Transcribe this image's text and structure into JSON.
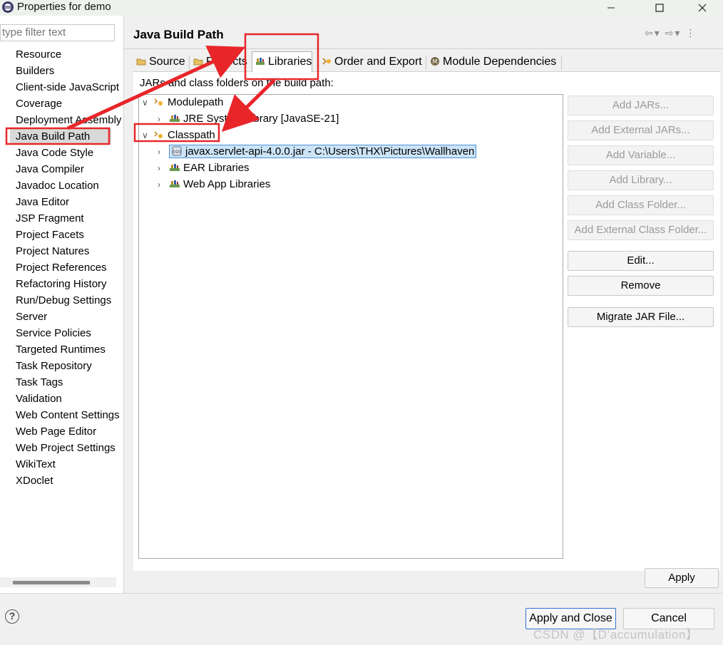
{
  "window": {
    "title": "Properties for demo"
  },
  "filter": {
    "placeholder": "type filter text"
  },
  "nav": {
    "items": [
      {
        "label": "Resource",
        "expandable": true
      },
      {
        "label": "Builders",
        "expandable": false
      },
      {
        "label": "Client-side JavaScript",
        "expandable": true
      },
      {
        "label": "Coverage",
        "expandable": false
      },
      {
        "label": "Deployment Assembly",
        "expandable": false
      },
      {
        "label": "Java Build Path",
        "expandable": false,
        "selected": true
      },
      {
        "label": "Java Code Style",
        "expandable": true
      },
      {
        "label": "Java Compiler",
        "expandable": true
      },
      {
        "label": "Javadoc Location",
        "expandable": false
      },
      {
        "label": "Java Editor",
        "expandable": true
      },
      {
        "label": "JSP Fragment",
        "expandable": false
      },
      {
        "label": "Project Facets",
        "expandable": false
      },
      {
        "label": "Project Natures",
        "expandable": false
      },
      {
        "label": "Project References",
        "expandable": false
      },
      {
        "label": "Refactoring History",
        "expandable": false
      },
      {
        "label": "Run/Debug Settings",
        "expandable": false
      },
      {
        "label": "Server",
        "expandable": false
      },
      {
        "label": "Service Policies",
        "expandable": false
      },
      {
        "label": "Targeted Runtimes",
        "expandable": false
      },
      {
        "label": "Task Repository",
        "expandable": true
      },
      {
        "label": "Task Tags",
        "expandable": false
      },
      {
        "label": "Validation",
        "expandable": true
      },
      {
        "label": "Web Content Settings",
        "expandable": false
      },
      {
        "label": "Web Page Editor",
        "expandable": false
      },
      {
        "label": "Web Project Settings",
        "expandable": false
      },
      {
        "label": "WikiText",
        "expandable": false
      },
      {
        "label": "XDoclet",
        "expandable": true
      }
    ]
  },
  "page": {
    "title": "Java Build Path"
  },
  "tabs": [
    {
      "label": "Source",
      "icon": "source-folder-icon"
    },
    {
      "label": "Projects",
      "icon": "projects-icon"
    },
    {
      "label": "Libraries",
      "icon": "libraries-icon",
      "active": true
    },
    {
      "label": "Order and Export",
      "icon": "order-export-icon"
    },
    {
      "label": "Module Dependencies",
      "icon": "module-icon"
    }
  ],
  "libraries": {
    "label": "JARs and class folders on the build path:",
    "tree": {
      "modulepath": "Modulepath",
      "jre": "JRE System Library [JavaSE-21]",
      "classpath": "Classpath",
      "jar": "javax.servlet-api-4.0.0.jar - C:\\Users\\THX\\Pictures\\Wallhaven",
      "ear": "EAR Libraries",
      "webapp": "Web App Libraries"
    }
  },
  "buttons": {
    "add_jars": "Add JARs...",
    "add_external_jars": "Add External JARs...",
    "add_variable": "Add Variable...",
    "add_library": "Add Library...",
    "add_class_folder": "Add Class Folder...",
    "add_external_class_folder": "Add External Class Folder...",
    "edit": "Edit...",
    "remove": "Remove",
    "migrate": "Migrate JAR File...",
    "apply": "Apply"
  },
  "footer": {
    "help": "?",
    "apply_close": "Apply and Close",
    "cancel": "Cancel",
    "watermark": "CSDN @【D’accumulation】"
  },
  "colors": {
    "annotation_red": "#e8262a",
    "selection_blue": "#cce4f7"
  }
}
